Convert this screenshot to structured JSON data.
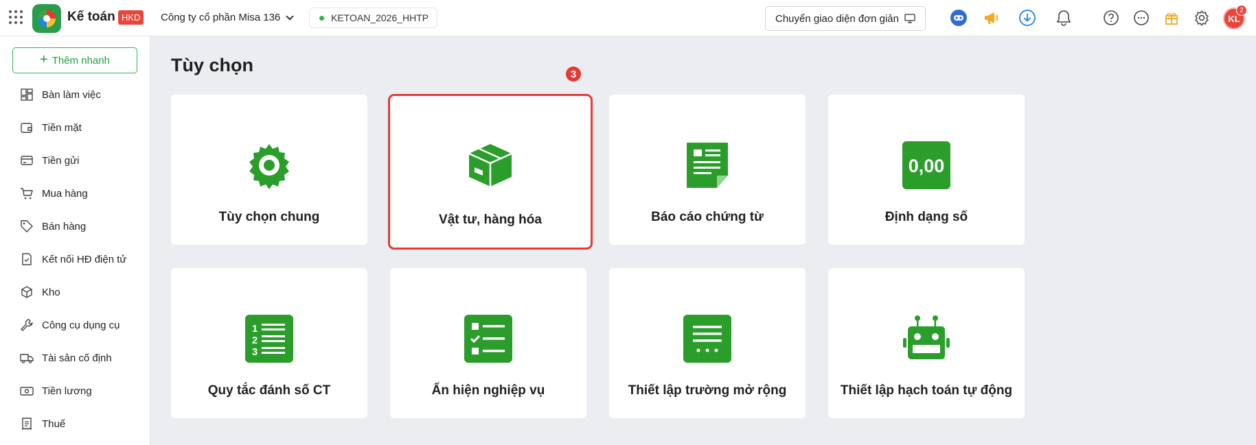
{
  "header": {
    "app_title": "Kế toán",
    "badge": "HKD",
    "company": "Công ty cổ phần Misa 136",
    "database": "KETOAN_2026_HHTP",
    "switch_ui_label": "Chuyển giao diện đơn giản",
    "avatar_initials": "KL",
    "notification_count": "2",
    "icons": [
      "apps-grid-icon",
      "app-logo",
      "chevron-down-icon",
      "monitor-icon",
      "ai-assistant-icon",
      "megaphone-icon",
      "download-icon",
      "bell-icon",
      "help-icon",
      "more-icon",
      "gift-icon",
      "gear-icon"
    ]
  },
  "sidebar": {
    "quick_add": "Thêm nhanh",
    "items": [
      {
        "label": "Bàn làm việc",
        "icon": "dashboard-icon"
      },
      {
        "label": "Tiền mặt",
        "icon": "wallet-icon"
      },
      {
        "label": "Tiền gửi",
        "icon": "card-icon"
      },
      {
        "label": "Mua hàng",
        "icon": "cart-icon"
      },
      {
        "label": "Bán hàng",
        "icon": "tag-icon"
      },
      {
        "label": "Kết nối HĐ điện tử",
        "icon": "invoice-icon"
      },
      {
        "label": "Kho",
        "icon": "box-icon"
      },
      {
        "label": "Công cụ dụng cụ",
        "icon": "wrench-icon"
      },
      {
        "label": "Tài sản cố định",
        "icon": "truck-icon"
      },
      {
        "label": "Tiền lương",
        "icon": "cash-icon"
      },
      {
        "label": "Thuế",
        "icon": "receipt-icon"
      }
    ]
  },
  "main": {
    "title": "Tùy chọn",
    "step_marker": "3",
    "cards": [
      {
        "label": "Tùy chọn chung",
        "icon": "gear-icon"
      },
      {
        "label": "Vật tư, hàng hóa",
        "icon": "package-icon",
        "highlighted": true
      },
      {
        "label": "Báo cáo chứng từ",
        "icon": "document-icon"
      },
      {
        "label": "Định dạng số",
        "icon": "number-format-icon",
        "icon_text": "0,00"
      },
      {
        "label": "Quy tắc đánh số CT",
        "icon": "numbered-list-icon"
      },
      {
        "label": "Ẩn hiện nghiệp vụ",
        "icon": "checklist-icon"
      },
      {
        "label": "Thiết lập trường mở rộng",
        "icon": "extended-fields-icon"
      },
      {
        "label": "Thiết lập hạch toán tự động",
        "icon": "robot-icon"
      }
    ]
  },
  "colors": {
    "accent_green": "#2a9d2a",
    "highlight_red": "#e53935",
    "badge_red": "#e8463c"
  }
}
